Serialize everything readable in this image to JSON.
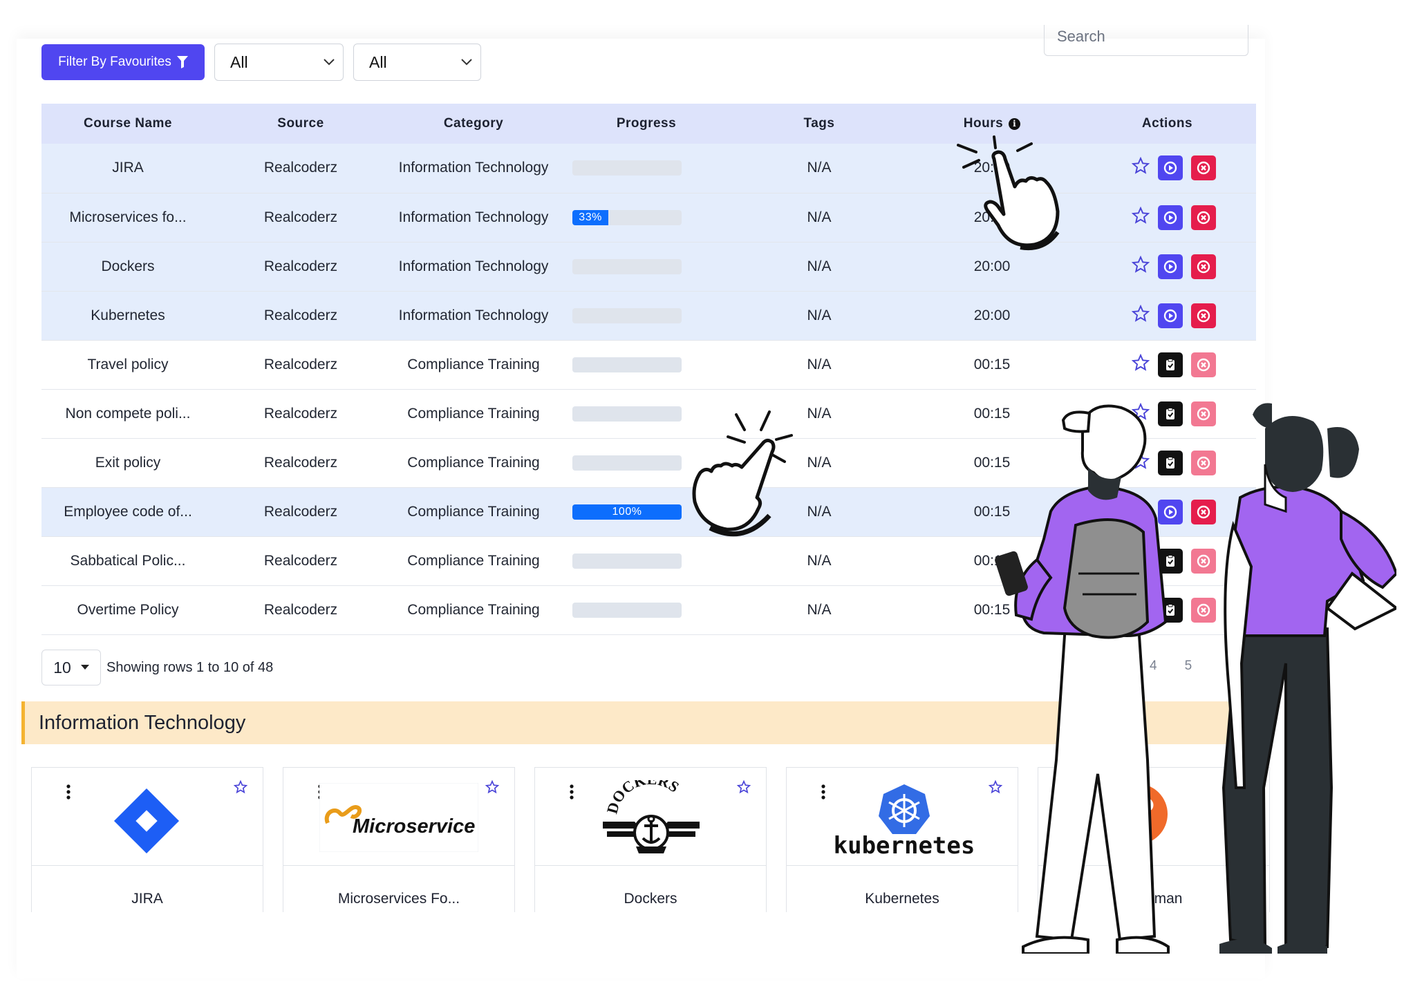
{
  "toolbar": {
    "filter_label": "Filter By Favourites",
    "select1_value": "All",
    "select2_value": "All",
    "search_placeholder": "Search"
  },
  "table": {
    "columns": [
      "Course Name",
      "Source",
      "Category",
      "Progress",
      "Tags",
      "Hours",
      "Actions"
    ],
    "rows": [
      {
        "name": "JIRA",
        "source": "Realcoderz",
        "category": "Information Technology",
        "progress": 0,
        "progress_label": "",
        "tags": "N/A",
        "hours": "20:00",
        "highlight": true,
        "action": "play"
      },
      {
        "name": "Microservices fo...",
        "source": "Realcoderz",
        "category": "Information Technology",
        "progress": 0.33,
        "progress_label": "33%",
        "tags": "N/A",
        "hours": "20:00",
        "highlight": true,
        "action": "play"
      },
      {
        "name": "Dockers",
        "source": "Realcoderz",
        "category": "Information Technology",
        "progress": 0,
        "progress_label": "",
        "tags": "N/A",
        "hours": "20:00",
        "highlight": true,
        "action": "play"
      },
      {
        "name": "Kubernetes",
        "source": "Realcoderz",
        "category": "Information Technology",
        "progress": 0,
        "progress_label": "",
        "tags": "N/A",
        "hours": "20:00",
        "highlight": true,
        "action": "play"
      },
      {
        "name": "Travel policy",
        "source": "Realcoderz",
        "category": "Compliance Training",
        "progress": 0,
        "progress_label": "",
        "tags": "N/A",
        "hours": "00:15",
        "highlight": false,
        "action": "clipboard"
      },
      {
        "name": "Non compete poli...",
        "source": "Realcoderz",
        "category": "Compliance Training",
        "progress": 0,
        "progress_label": "",
        "tags": "N/A",
        "hours": "00:15",
        "highlight": false,
        "action": "clipboard"
      },
      {
        "name": "Exit policy",
        "source": "Realcoderz",
        "category": "Compliance Training",
        "progress": 0,
        "progress_label": "",
        "tags": "N/A",
        "hours": "00:15",
        "highlight": false,
        "action": "clipboard"
      },
      {
        "name": "Employee code of...",
        "source": "Realcoderz",
        "category": "Compliance Training",
        "progress": 1.0,
        "progress_label": "100%",
        "tags": "N/A",
        "hours": "00:15",
        "highlight": true,
        "action": "play"
      },
      {
        "name": "Sabbatical Polic...",
        "source": "Realcoderz",
        "category": "Compliance Training",
        "progress": 0,
        "progress_label": "",
        "tags": "N/A",
        "hours": "00:15",
        "highlight": false,
        "action": "clipboard"
      },
      {
        "name": "Overtime Policy",
        "source": "Realcoderz",
        "category": "Compliance Training",
        "progress": 0,
        "progress_label": "",
        "tags": "N/A",
        "hours": "00:15",
        "highlight": false,
        "action": "clipboard"
      }
    ]
  },
  "footer": {
    "page_size": "10",
    "rows_info": "Showing rows 1 to 10 of 48",
    "pages": [
      "4",
      "5"
    ]
  },
  "section": {
    "title": "Information Technology"
  },
  "cards": [
    {
      "title": "JIRA",
      "logo": "jira-logo"
    },
    {
      "title": "Microservices Fo...",
      "logo": "microservice-logo",
      "logo_text": "Microservice"
    },
    {
      "title": "Dockers",
      "logo": "dockers-logo",
      "logo_text": "DOCKERS"
    },
    {
      "title": "Kubernetes",
      "logo": "kubernetes-logo",
      "logo_text": "kubernetes"
    },
    {
      "title": "Postman",
      "logo": "postman-logo"
    }
  ],
  "colors": {
    "primary": "#5046f0",
    "danger": "#e51d4c",
    "progress": "#0d6efd",
    "header_bg": "#dde3fb",
    "row_highlight": "#e4edfc",
    "section_bg": "#fde9c8",
    "section_accent": "#f4b331",
    "illustration_purple": "#a265f0"
  },
  "icons": {
    "filter": "funnel-icon",
    "dropdown": "chevron-down-icon",
    "info": "info-icon",
    "favourite": "star-outline-icon",
    "play": "play-circle-icon",
    "clipboard": "clipboard-check-icon",
    "delete": "close-circle-icon",
    "menu": "kebab-menu-icon"
  }
}
